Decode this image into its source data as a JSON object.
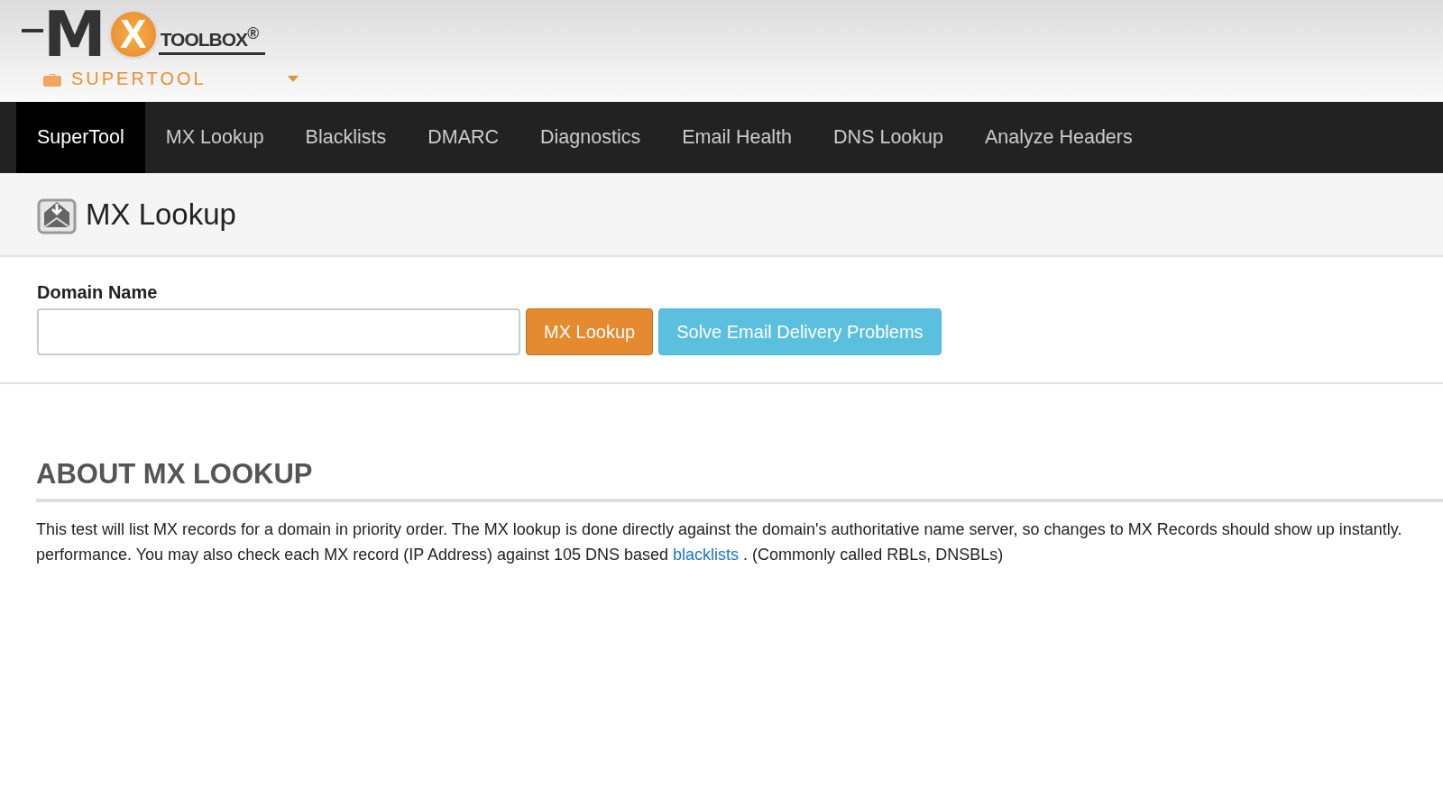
{
  "logo": {
    "letter_m": "M",
    "letter_x": "X",
    "wordmark": "TOOLBOX$^{®}$",
    "product": "SUPERTOOL"
  },
  "nav": [
    {
      "label": "SuperTool",
      "selected": true
    },
    {
      "label": "MX Lookup",
      "selected": false
    },
    {
      "label": "Blacklists",
      "selected": false
    },
    {
      "label": "DMARC",
      "selected": false
    },
    {
      "label": "Diagnostics",
      "selected": false
    },
    {
      "label": "Email Health",
      "selected": false
    },
    {
      "label": "DNS Lookup",
      "selected": false
    },
    {
      "label": "Analyze Headers",
      "selected": false
    }
  ],
  "page_title": "MX Lookup",
  "form": {
    "label": "Domain Name",
    "lookup_button": "MX Lookup",
    "help_button": "Solve Email Delivery Problems"
  },
  "about": {
    "heading": "ABOUT MX LOOKUP",
    "line_1": "This test will list MX records for a domain in priority order. The MX lookup is done directly against the domain's authoritative name server, so changes to MX Records should show up instantly.",
    "line_2_before": "performance. You may also check each MX record (IP Address) against 105 DNS based",
    "line_2_link": "blacklists",
    "line_2_after": ". (Commonly called RBLs, DNSBLs)"
  }
}
